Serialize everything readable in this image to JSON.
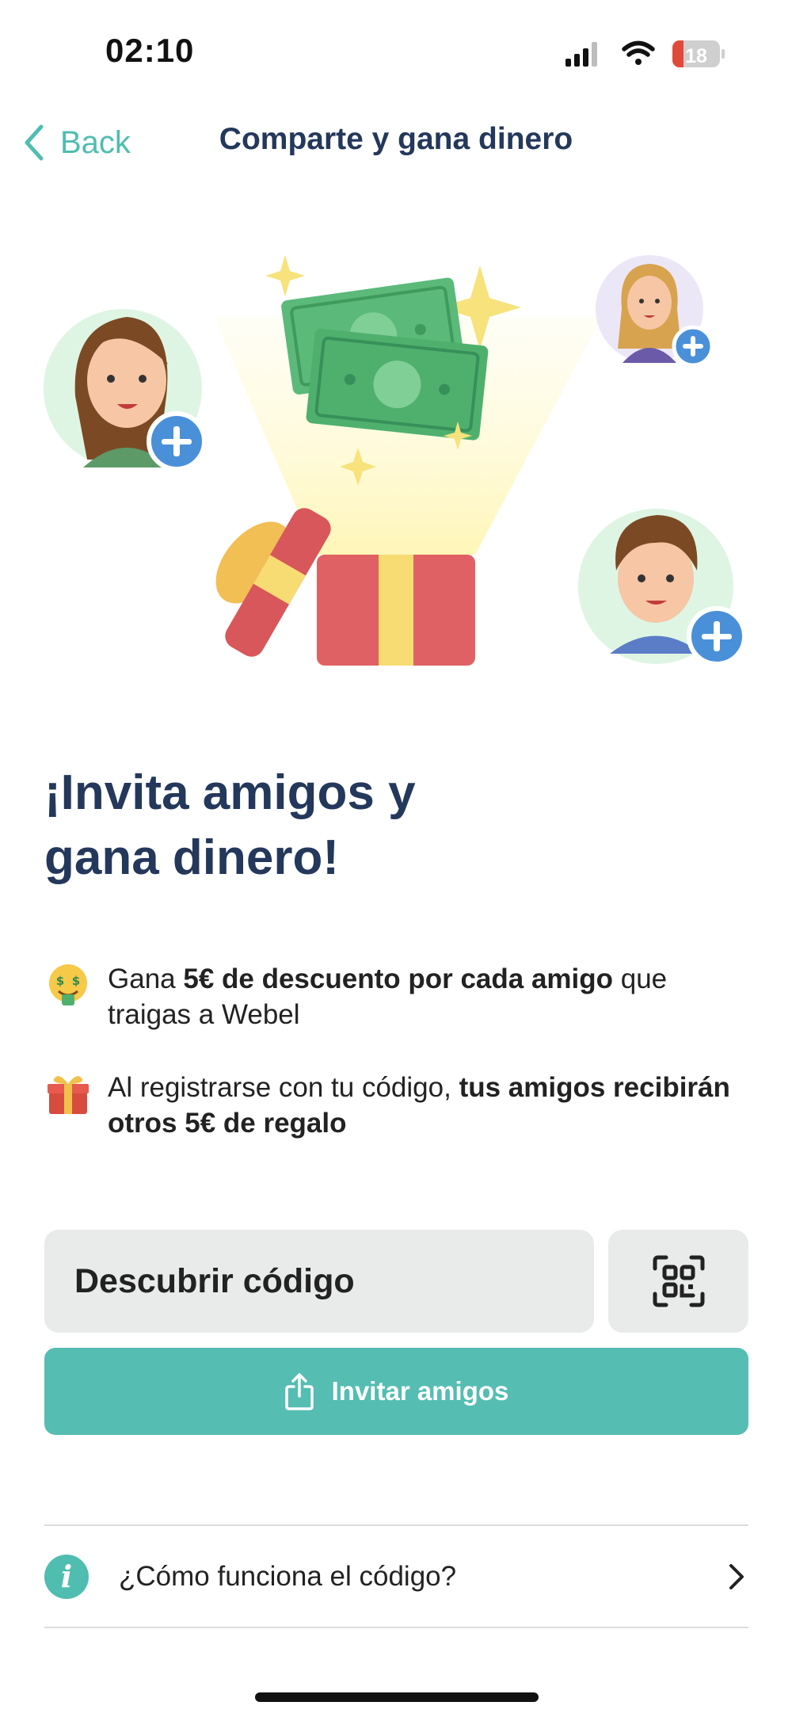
{
  "status_bar": {
    "time": "02:10",
    "battery": "18",
    "icons": [
      "signal-icon",
      "wifi-icon",
      "battery-icon"
    ]
  },
  "nav": {
    "back_label": "Back",
    "title": "Comparte y gana dinero"
  },
  "headline": {
    "line1": "¡Invita amigos y",
    "line2": "gana dinero!"
  },
  "bullets": [
    {
      "icon": "money-face-emoji",
      "text_before": "Gana ",
      "text_bold": "5€ de descuento por cada amigo",
      "text_after": " que traigas a Webel"
    },
    {
      "icon": "gift-emoji",
      "text_before": "Al registrarse con tu código, ",
      "text_bold": "tus amigos recibirán otros 5€ de regalo",
      "text_after": ""
    }
  ],
  "code": {
    "discover_label": "Descubrir código",
    "qr_icon": "qr-code-icon"
  },
  "invite": {
    "label": "Invitar amigos",
    "icon": "share-icon"
  },
  "how": {
    "label": "¿Cómo funciona el código?",
    "icon_letter": "i"
  },
  "colors": {
    "accent": "#55bdb2",
    "title": "#24385b",
    "field_bg": "#e9ebeb",
    "plus_badge": "#4a90d9"
  }
}
